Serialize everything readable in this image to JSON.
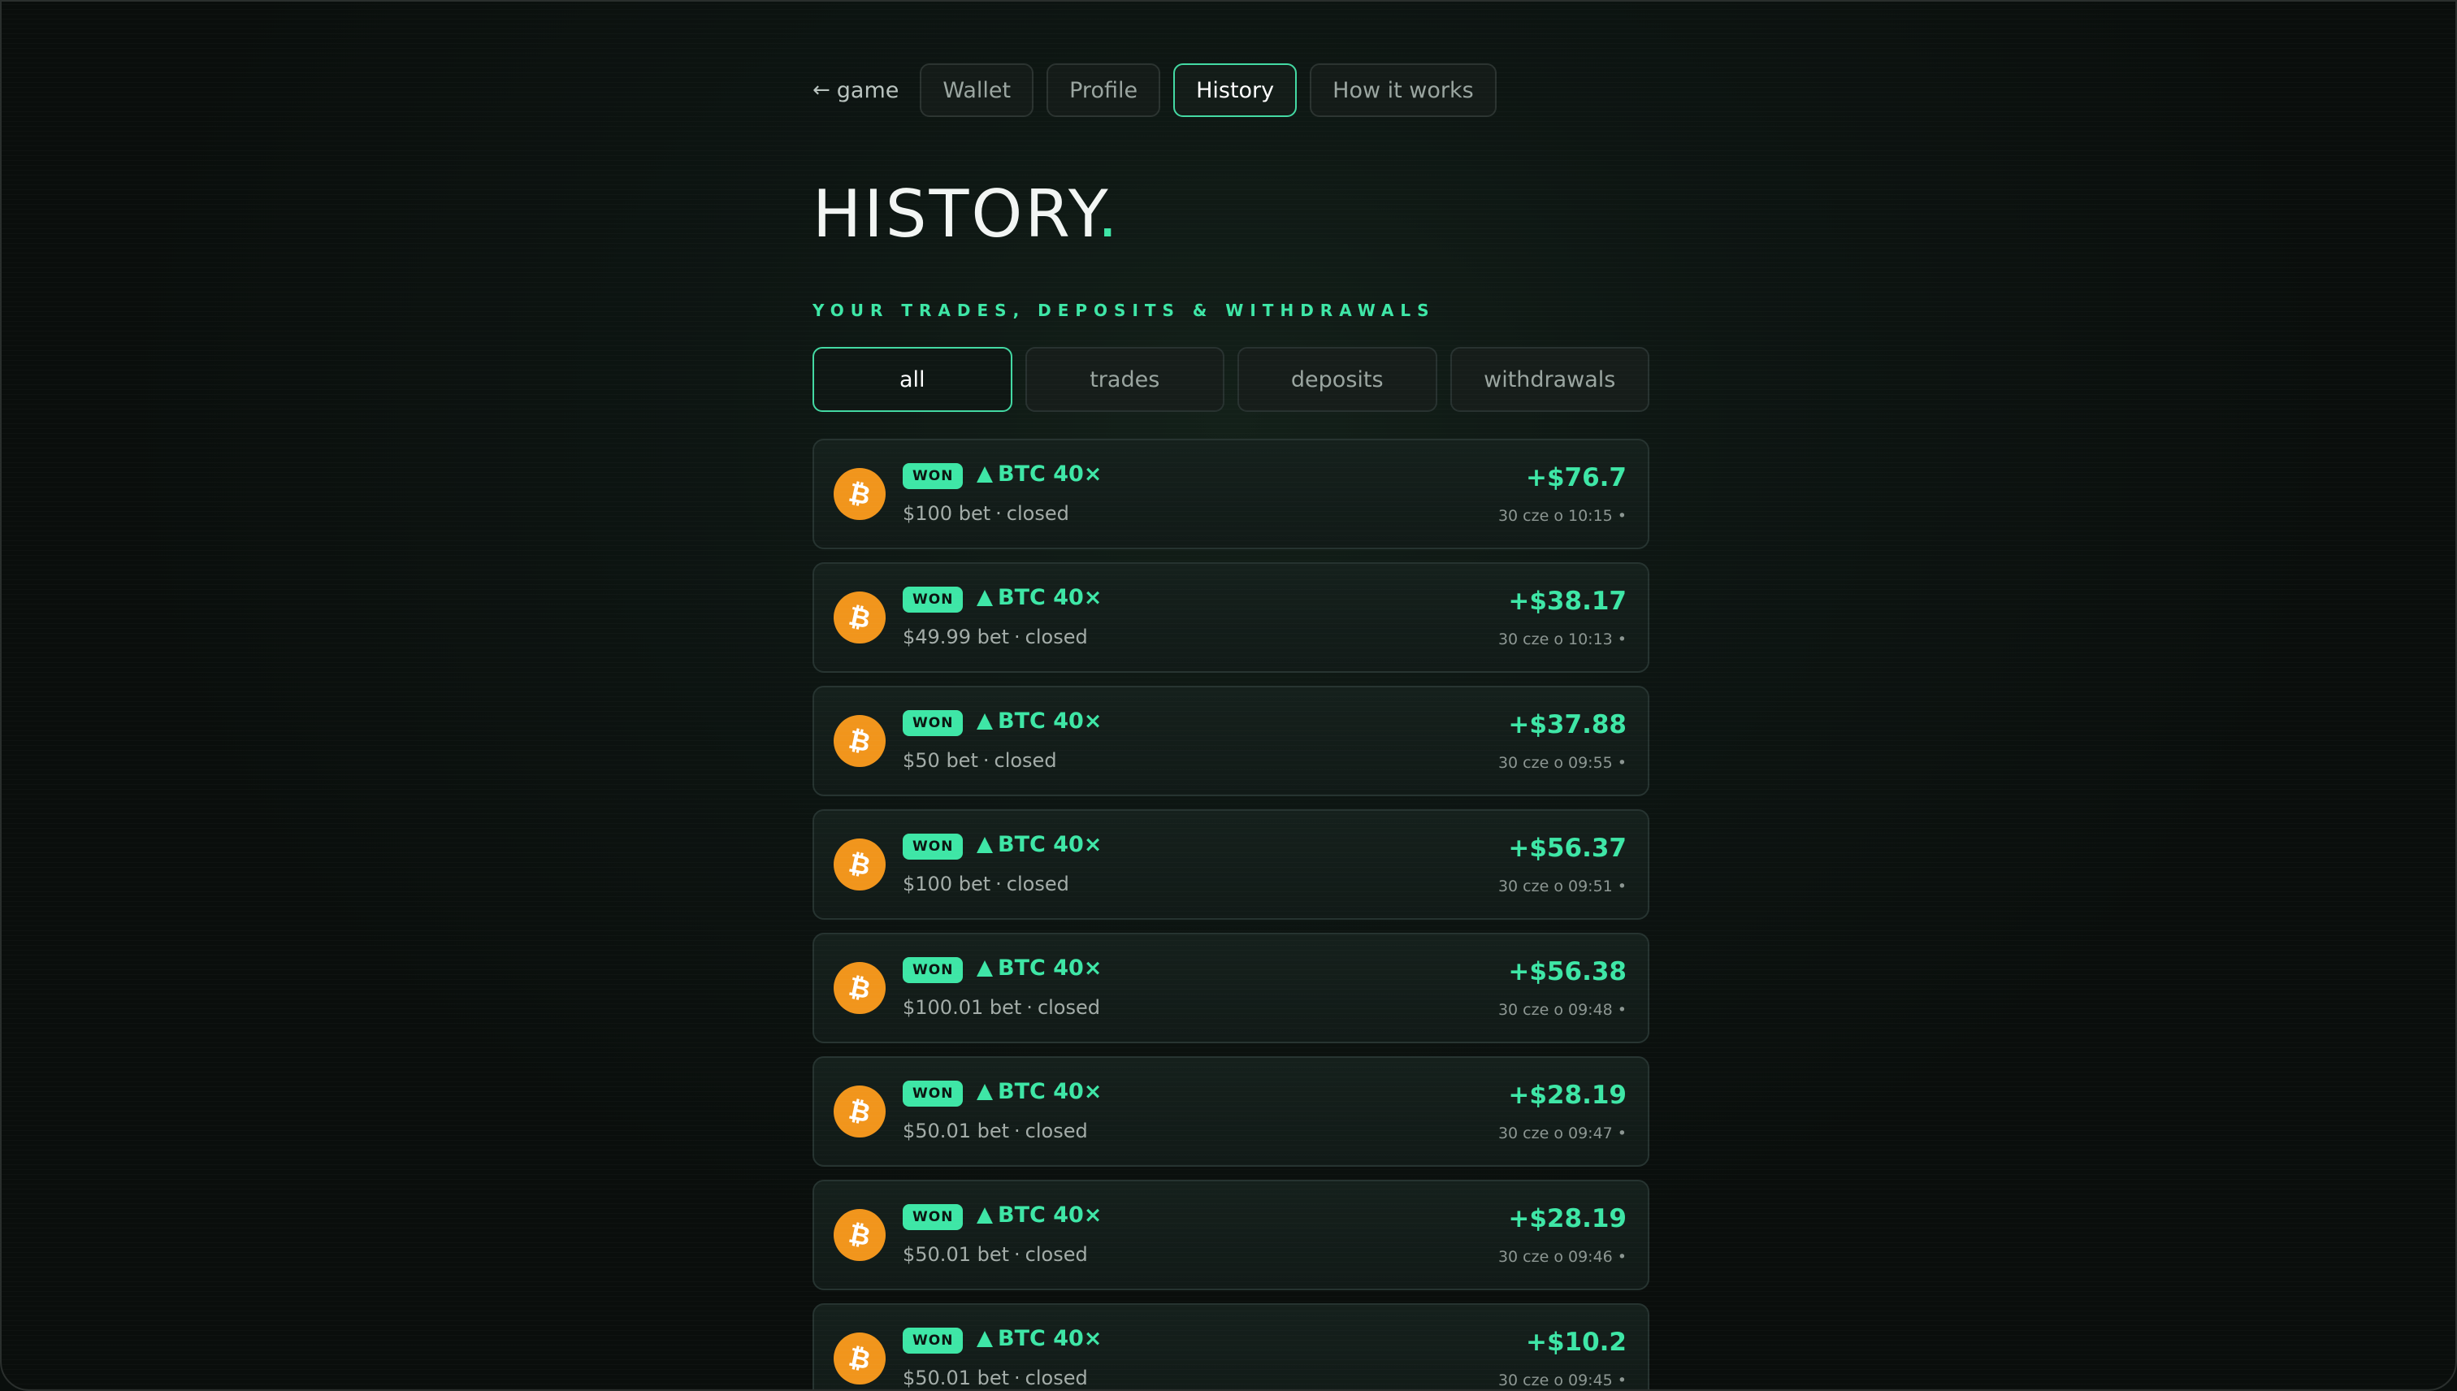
{
  "nav": {
    "back_label": "game",
    "tabs": [
      "Wallet",
      "Profile",
      "History",
      "How it works"
    ],
    "active_tab": "History"
  },
  "page": {
    "title": "HISTORY",
    "title_dot": ".",
    "subtitle": "YOUR TRADES, DEPOSITS & WITHDRAWALS"
  },
  "filters": [
    "all",
    "trades",
    "deposits",
    "withdrawals"
  ],
  "active_filter": "all",
  "colors": {
    "accent": "#3ee6a6",
    "bitcoin": "#f1951c"
  },
  "history": [
    {
      "status": "WON",
      "pair": "BTC 40×",
      "bet": "$100 bet",
      "state": "closed",
      "amount": "+$76.7",
      "time": "30 cze o 10:15 •"
    },
    {
      "status": "WON",
      "pair": "BTC 40×",
      "bet": "$49.99 bet",
      "state": "closed",
      "amount": "+$38.17",
      "time": "30 cze o 10:13 •"
    },
    {
      "status": "WON",
      "pair": "BTC 40×",
      "bet": "$50 bet",
      "state": "closed",
      "amount": "+$37.88",
      "time": "30 cze o 09:55 •"
    },
    {
      "status": "WON",
      "pair": "BTC 40×",
      "bet": "$100 bet",
      "state": "closed",
      "amount": "+$56.37",
      "time": "30 cze o 09:51 •"
    },
    {
      "status": "WON",
      "pair": "BTC 40×",
      "bet": "$100.01 bet",
      "state": "closed",
      "amount": "+$56.38",
      "time": "30 cze o 09:48 •"
    },
    {
      "status": "WON",
      "pair": "BTC 40×",
      "bet": "$50.01 bet",
      "state": "closed",
      "amount": "+$28.19",
      "time": "30 cze o 09:47 •"
    },
    {
      "status": "WON",
      "pair": "BTC 40×",
      "bet": "$50.01 bet",
      "state": "closed",
      "amount": "+$28.19",
      "time": "30 cze o 09:46 •"
    },
    {
      "status": "WON",
      "pair": "BTC 40×",
      "bet": "$50.01 bet",
      "state": "closed",
      "amount": "+$10.2",
      "time": "30 cze o 09:45 •"
    }
  ]
}
